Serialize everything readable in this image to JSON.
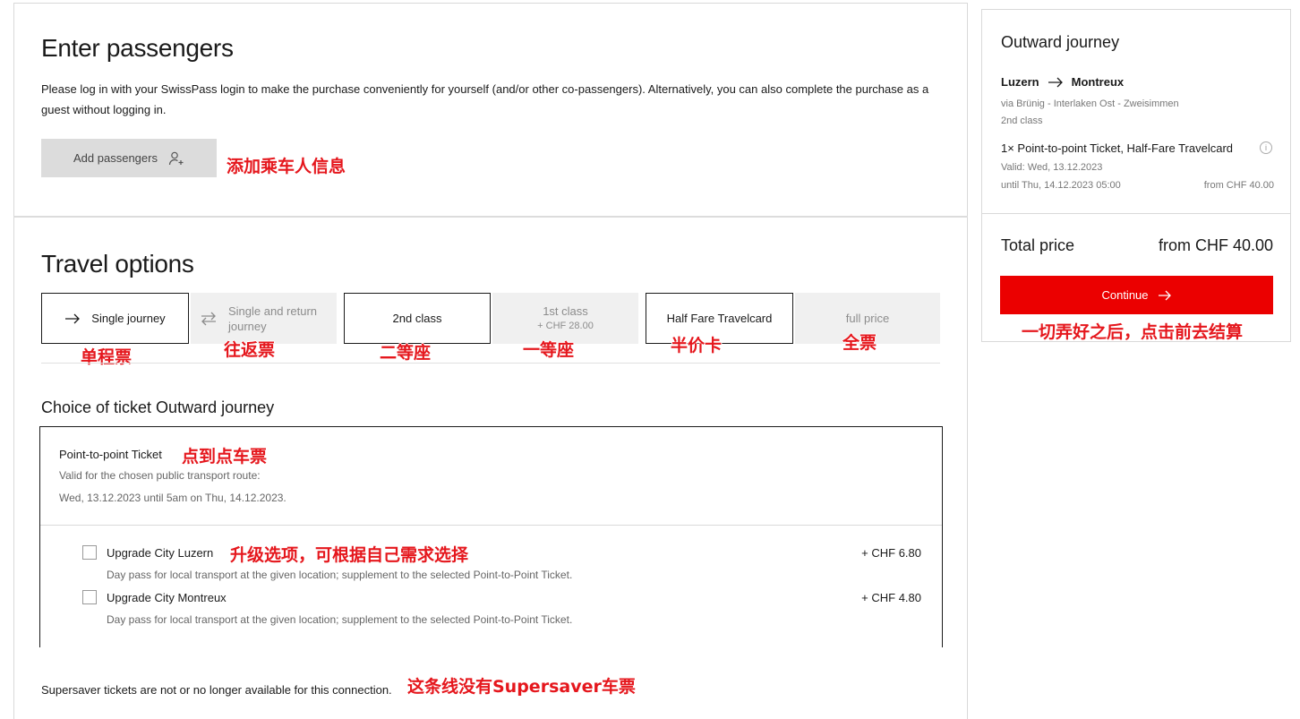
{
  "passengers": {
    "title": "Enter passengers",
    "description": "Please log in with your SwissPass login to make the purchase conveniently for yourself (and/or other co-passengers). Alternatively, you can also complete the purchase as a guest without logging in.",
    "add_button": "Add passengers",
    "add_icon": "user-plus-icon"
  },
  "travel_options": {
    "title": "Travel options",
    "options": [
      {
        "label": "Single journey",
        "selected": true,
        "icon": "arrow-right-icon"
      },
      {
        "label": "Single and return journey",
        "selected": false,
        "icon": "swap-arrows-icon"
      },
      {
        "label": "2nd class",
        "selected": true
      },
      {
        "label": "1st class",
        "sub": "+ CHF 28.00",
        "selected": false
      },
      {
        "label": "Half Fare Travelcard",
        "selected": true
      },
      {
        "label": "full price",
        "selected": false
      }
    ]
  },
  "ticket_choice": {
    "title": "Choice of ticket Outward journey",
    "ticket_name": "Point-to-point Ticket",
    "valid_line1": "Valid for the chosen public transport route:",
    "valid_line2": "Wed, 13.12.2023 until 5am on Thu, 14.12.2023.",
    "upgrades": [
      {
        "label": "Upgrade City Luzern",
        "desc": "Day pass for local transport at the given location; supplement to the selected Point-to-Point Ticket.",
        "price": "+ CHF 6.80",
        "checked": false
      },
      {
        "label": "Upgrade City Montreux",
        "desc": "Day pass for local transport at the given location; supplement to the selected Point-to-Point Ticket.",
        "price": "+ CHF 4.80",
        "checked": false
      }
    ]
  },
  "supersaver_note": "Supersaver tickets are not or no longer available for this connection.",
  "sidebar": {
    "title": "Outward journey",
    "from": "Luzern",
    "to": "Montreux",
    "via": "via Brünig - Interlaken Ost - Zweisimmen",
    "class": "2nd class",
    "ticket": "1× Point-to-point Ticket, Half-Fare Travelcard",
    "valid": "Valid: Wed, 13.12.2023",
    "until": "until Thu, 14.12.2023 05:00",
    "from_price": "from CHF 40.00",
    "total_label": "Total price",
    "total_value": "from CHF 40.00",
    "continue": "Continue",
    "brand_color": "#eb0000"
  },
  "annotations": {
    "add_passengers": "添加乘车人信息",
    "single": "单程票",
    "return": "往返票",
    "second_class": "二等座",
    "first_class": "一等座",
    "half_fare": "半价卡",
    "full_price": "全票",
    "p2p": "点到点车票",
    "upgrade": "升级选项，可根据自己需求选择",
    "supersaver": "这条线没有Supersaver车票",
    "continue": "一切弄好之后，点击前去结算"
  }
}
